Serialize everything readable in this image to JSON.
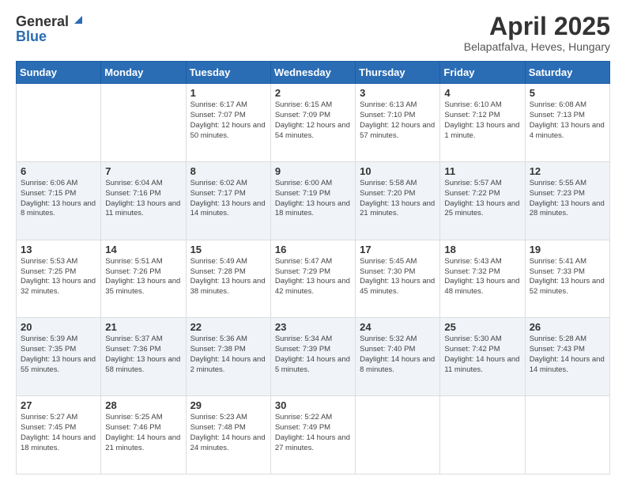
{
  "header": {
    "logo_general": "General",
    "logo_blue": "Blue",
    "title": "April 2025",
    "subtitle": "Belapatfalva, Heves, Hungary"
  },
  "weekdays": [
    "Sunday",
    "Monday",
    "Tuesday",
    "Wednesday",
    "Thursday",
    "Friday",
    "Saturday"
  ],
  "weeks": [
    [
      {
        "day": "",
        "info": ""
      },
      {
        "day": "",
        "info": ""
      },
      {
        "day": "1",
        "info": "Sunrise: 6:17 AM\nSunset: 7:07 PM\nDaylight: 12 hours and 50 minutes."
      },
      {
        "day": "2",
        "info": "Sunrise: 6:15 AM\nSunset: 7:09 PM\nDaylight: 12 hours and 54 minutes."
      },
      {
        "day": "3",
        "info": "Sunrise: 6:13 AM\nSunset: 7:10 PM\nDaylight: 12 hours and 57 minutes."
      },
      {
        "day": "4",
        "info": "Sunrise: 6:10 AM\nSunset: 7:12 PM\nDaylight: 13 hours and 1 minute."
      },
      {
        "day": "5",
        "info": "Sunrise: 6:08 AM\nSunset: 7:13 PM\nDaylight: 13 hours and 4 minutes."
      }
    ],
    [
      {
        "day": "6",
        "info": "Sunrise: 6:06 AM\nSunset: 7:15 PM\nDaylight: 13 hours and 8 minutes."
      },
      {
        "day": "7",
        "info": "Sunrise: 6:04 AM\nSunset: 7:16 PM\nDaylight: 13 hours and 11 minutes."
      },
      {
        "day": "8",
        "info": "Sunrise: 6:02 AM\nSunset: 7:17 PM\nDaylight: 13 hours and 14 minutes."
      },
      {
        "day": "9",
        "info": "Sunrise: 6:00 AM\nSunset: 7:19 PM\nDaylight: 13 hours and 18 minutes."
      },
      {
        "day": "10",
        "info": "Sunrise: 5:58 AM\nSunset: 7:20 PM\nDaylight: 13 hours and 21 minutes."
      },
      {
        "day": "11",
        "info": "Sunrise: 5:57 AM\nSunset: 7:22 PM\nDaylight: 13 hours and 25 minutes."
      },
      {
        "day": "12",
        "info": "Sunrise: 5:55 AM\nSunset: 7:23 PM\nDaylight: 13 hours and 28 minutes."
      }
    ],
    [
      {
        "day": "13",
        "info": "Sunrise: 5:53 AM\nSunset: 7:25 PM\nDaylight: 13 hours and 32 minutes."
      },
      {
        "day": "14",
        "info": "Sunrise: 5:51 AM\nSunset: 7:26 PM\nDaylight: 13 hours and 35 minutes."
      },
      {
        "day": "15",
        "info": "Sunrise: 5:49 AM\nSunset: 7:28 PM\nDaylight: 13 hours and 38 minutes."
      },
      {
        "day": "16",
        "info": "Sunrise: 5:47 AM\nSunset: 7:29 PM\nDaylight: 13 hours and 42 minutes."
      },
      {
        "day": "17",
        "info": "Sunrise: 5:45 AM\nSunset: 7:30 PM\nDaylight: 13 hours and 45 minutes."
      },
      {
        "day": "18",
        "info": "Sunrise: 5:43 AM\nSunset: 7:32 PM\nDaylight: 13 hours and 48 minutes."
      },
      {
        "day": "19",
        "info": "Sunrise: 5:41 AM\nSunset: 7:33 PM\nDaylight: 13 hours and 52 minutes."
      }
    ],
    [
      {
        "day": "20",
        "info": "Sunrise: 5:39 AM\nSunset: 7:35 PM\nDaylight: 13 hours and 55 minutes."
      },
      {
        "day": "21",
        "info": "Sunrise: 5:37 AM\nSunset: 7:36 PM\nDaylight: 13 hours and 58 minutes."
      },
      {
        "day": "22",
        "info": "Sunrise: 5:36 AM\nSunset: 7:38 PM\nDaylight: 14 hours and 2 minutes."
      },
      {
        "day": "23",
        "info": "Sunrise: 5:34 AM\nSunset: 7:39 PM\nDaylight: 14 hours and 5 minutes."
      },
      {
        "day": "24",
        "info": "Sunrise: 5:32 AM\nSunset: 7:40 PM\nDaylight: 14 hours and 8 minutes."
      },
      {
        "day": "25",
        "info": "Sunrise: 5:30 AM\nSunset: 7:42 PM\nDaylight: 14 hours and 11 minutes."
      },
      {
        "day": "26",
        "info": "Sunrise: 5:28 AM\nSunset: 7:43 PM\nDaylight: 14 hours and 14 minutes."
      }
    ],
    [
      {
        "day": "27",
        "info": "Sunrise: 5:27 AM\nSunset: 7:45 PM\nDaylight: 14 hours and 18 minutes."
      },
      {
        "day": "28",
        "info": "Sunrise: 5:25 AM\nSunset: 7:46 PM\nDaylight: 14 hours and 21 minutes."
      },
      {
        "day": "29",
        "info": "Sunrise: 5:23 AM\nSunset: 7:48 PM\nDaylight: 14 hours and 24 minutes."
      },
      {
        "day": "30",
        "info": "Sunrise: 5:22 AM\nSunset: 7:49 PM\nDaylight: 14 hours and 27 minutes."
      },
      {
        "day": "",
        "info": ""
      },
      {
        "day": "",
        "info": ""
      },
      {
        "day": "",
        "info": ""
      }
    ]
  ]
}
